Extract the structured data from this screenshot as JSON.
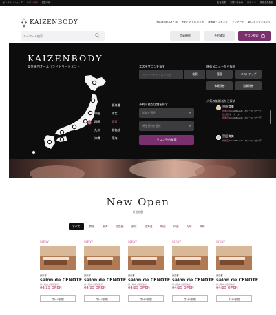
{
  "topbar": {
    "left": [
      "オンラインショップ",
      "サロン予約",
      "提携予約"
    ],
    "left_selected_index": 1,
    "right": [
      "会社概要",
      "お問い合わせ",
      "ログイン",
      "新規会員登録"
    ]
  },
  "header": {
    "logo": "KAIZENBODY",
    "nav": [
      "KAIZENBODYとは",
      "予約・お支払い方法",
      "施術者ランキング",
      "アンケート",
      "新コインランキング"
    ],
    "search_placeholder": "キーワード検索",
    "buttons": {
      "members": "会員機能",
      "reservation": "予約確認",
      "salon_search": "サロン検索"
    }
  },
  "hero": {
    "brand": "KAIZENBODY",
    "tagline": "女性専門オールハンドトリートメント",
    "regions": [
      {
        "label": "北海道",
        "selected": false
      },
      {
        "label": "中国",
        "selected": false
      },
      {
        "label": "東北",
        "selected": false
      },
      {
        "label": "四国",
        "selected": false
      },
      {
        "label": "関東",
        "selected": true
      },
      {
        "label": "九州",
        "selected": false
      },
      {
        "label": "北信越",
        "selected": false
      },
      {
        "label": "沖縄",
        "selected": false
      },
      {
        "label": "東海",
        "selected": false
      }
    ],
    "salon_search": {
      "heading": "エステサロンを探す",
      "keyword_placeholder": "キーワードやサロン名を",
      "search_button": "検索"
    },
    "booking": {
      "heading": "予約可能な店舗を探す",
      "area_placeholder": "地域を選択",
      "date_placeholder": "希望日時を選択",
      "submit": "サロン予約検索"
    },
    "menu": {
      "heading": "施術メニューから探す",
      "items": [
        "痩身",
        "バストアップ",
        "体質改善",
        "肌質改善"
      ]
    },
    "ranking": {
      "heading": "人気の施術者から探す",
      "entries": [
        {
          "name": "窪田育美",
          "lines": [
            {
              "label": "所属店",
              "value": "Small Beauty 15(オール・ガーデ)"
            },
            {
              "label": "担当者",
              "value": "オーナーヌ"
            },
            {
              "label": "所属店",
              "value": "Small Beauty 15(オール・ガーデ)"
            }
          ]
        },
        {
          "name": "窪田育美",
          "lines": [
            {
              "label": "所属店",
              "value": "Small Beauty 15(オール・ガーデ)"
            }
          ]
        }
      ]
    }
  },
  "new_open": {
    "title": "New Open",
    "subtitle": "新規店舗",
    "filters": [
      "すべて",
      "関東",
      "東海",
      "北信越",
      "東北",
      "北海道",
      "中国",
      "四国",
      "九州",
      "沖縄"
    ],
    "active_filter_index": 0,
    "cards": [
      {
        "badge": "NEW",
        "prefecture": "東京都",
        "name": "salon de CENOTE",
        "description": "骨と筋肉と循環改善",
        "open_date": "04/25 OPEN",
        "button": "サロン詳細"
      },
      {
        "badge": "NEW",
        "prefecture": "東京都",
        "name": "salon de CENOTE",
        "description": "骨と筋肉と循環改善",
        "open_date": "04/25 OPEN",
        "button": "サロン詳細"
      },
      {
        "badge": "NEW",
        "prefecture": "東京都",
        "name": "salon de CENOTE",
        "description": "骨と筋肉と循環改善",
        "open_date": "04/25 OPEN",
        "button": "サロン詳細"
      },
      {
        "badge": "NEW",
        "prefecture": "東京都",
        "name": "salon de CENOTE",
        "description": "骨と筋肉と循環改善",
        "open_date": "04/25 OPEN",
        "button": "サロン詳細"
      },
      {
        "badge": "NEW",
        "prefecture": "東京都",
        "name": "salon de CENOTE",
        "description": "骨と筋肉と循環改善",
        "open_date": "04/25 OPEN",
        "button": "サロン詳細"
      }
    ]
  },
  "colors": {
    "accent_purple": "#7a2f6e",
    "accent_pink": "#d06a9a",
    "dark_bg": "#0d0d0d"
  },
  "icons": [
    "logo-mark-icon",
    "search-icon",
    "bag-icon",
    "japan-map-icon",
    "chevron-down-icon",
    "avatar-icon"
  ]
}
